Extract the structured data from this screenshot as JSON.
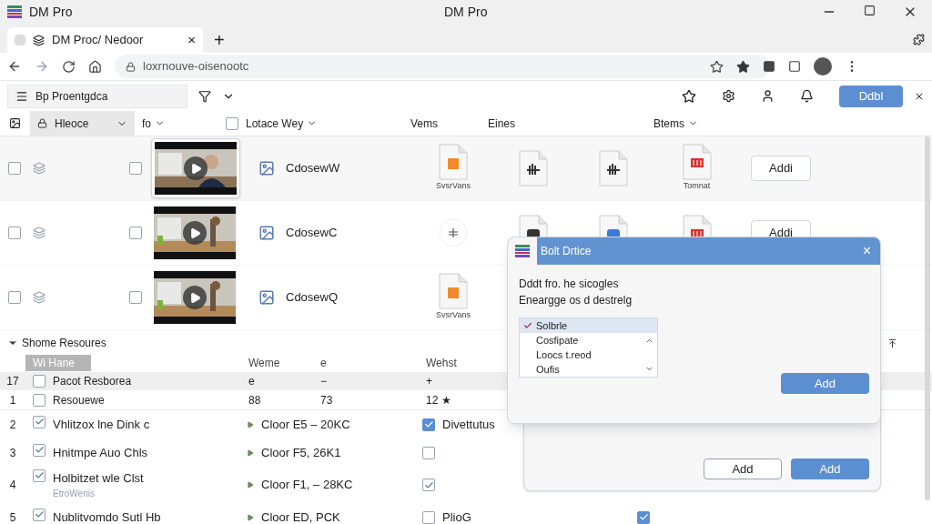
{
  "window": {
    "title": "DM Pro",
    "app_name": "DM Pro"
  },
  "browser": {
    "tab": {
      "title": "DM Proc/ Nedoor",
      "close": "×",
      "selected": true
    },
    "new_tab": "+",
    "url": "loxrnouve-oisenootc"
  },
  "toolbar": {
    "search": {
      "value": "Bp Proentgdca"
    },
    "primary_button": "Ddbl"
  },
  "columns": [
    {
      "label": "Hleoce",
      "kind": "dropdown"
    },
    {
      "label": "fo",
      "kind": "menu"
    },
    {
      "label": "Lotace Wey",
      "kind": "check-menu",
      "checked": false
    },
    {
      "label": "Vems",
      "kind": "plain"
    },
    {
      "label": "Eines",
      "kind": "plain"
    },
    {
      "label": "Btems",
      "kind": "menu"
    }
  ],
  "media_rows": [
    {
      "checked": false,
      "marked": false,
      "selected": true,
      "name": "CdosewW",
      "files": [
        {
          "kind": "orange-doc",
          "caption": "SvsrVans"
        },
        {
          "kind": "audio"
        },
        {
          "kind": "audio"
        },
        {
          "kind": "red-doc",
          "caption": "Tomnat"
        }
      ],
      "action": "Addi"
    },
    {
      "checked": false,
      "marked": false,
      "selected": false,
      "name": "CdosewC",
      "files": [
        {
          "kind": "plus-circle"
        },
        {
          "kind": "dark-doc"
        },
        {
          "kind": "blue-doc"
        },
        {
          "kind": "red-doc"
        }
      ],
      "action": "Addi"
    },
    {
      "checked": false,
      "marked": false,
      "selected": false,
      "name": "CdosewQ",
      "files": [
        {
          "kind": "orange-doc",
          "caption": "SvsrVans"
        }
      ]
    }
  ],
  "resources": {
    "title": "Shome Resoures",
    "expanded": true,
    "columns": [
      "Wi Hane",
      "Weme",
      "e",
      "Wehst"
    ],
    "group": {
      "index": "17",
      "checked": false,
      "label": "Pacot Resborea",
      "col_2": "e",
      "col_3": "−",
      "col_4": "+"
    },
    "summary": {
      "index": "1",
      "checked": false,
      "name": "Resouewe",
      "col_2": "88",
      "col_3": "73",
      "col_4": "12 ★"
    },
    "rows": [
      {
        "index": "2",
        "checked": true,
        "name": "Vhlitzox lne Dink c",
        "value": "Cloor E5 – 20KC",
        "flag": true,
        "flag_label": "Divettutus"
      },
      {
        "index": "3",
        "checked": true,
        "name": "Hnitmpe Auo Chls",
        "value": "Cloor F5,  26K1",
        "flag": false
      },
      {
        "index": "4",
        "checked": true,
        "name": "Holbitzet wle Clst",
        "sub": "EtroWenis",
        "value": "Cloor F1, – 28KC",
        "flag": true
      },
      {
        "index": "5",
        "checked": true,
        "name": "Nublitvomdo Sutl Hb",
        "value": "Cloor ED,  PCK",
        "flag": false,
        "flag_label": "PlioG",
        "extra_checked": true
      }
    ]
  },
  "dialog": {
    "title": "Bolt Drtice",
    "close": "×",
    "lines": [
      "Dddt fro. he sicogles",
      "Eneargge os d destrelg"
    ],
    "options": [
      {
        "label": "Solbrle",
        "selected": true
      },
      {
        "label": "Cosfipate",
        "selected": false
      },
      {
        "label": "Loocs t.reod",
        "selected": false
      },
      {
        "label": "Oufis",
        "selected": false
      }
    ],
    "button": "Add"
  },
  "back_dialog": {
    "buttons": [
      {
        "label": "Add",
        "kind": "secondary"
      },
      {
        "label": "Add",
        "kind": "primary"
      }
    ]
  }
}
